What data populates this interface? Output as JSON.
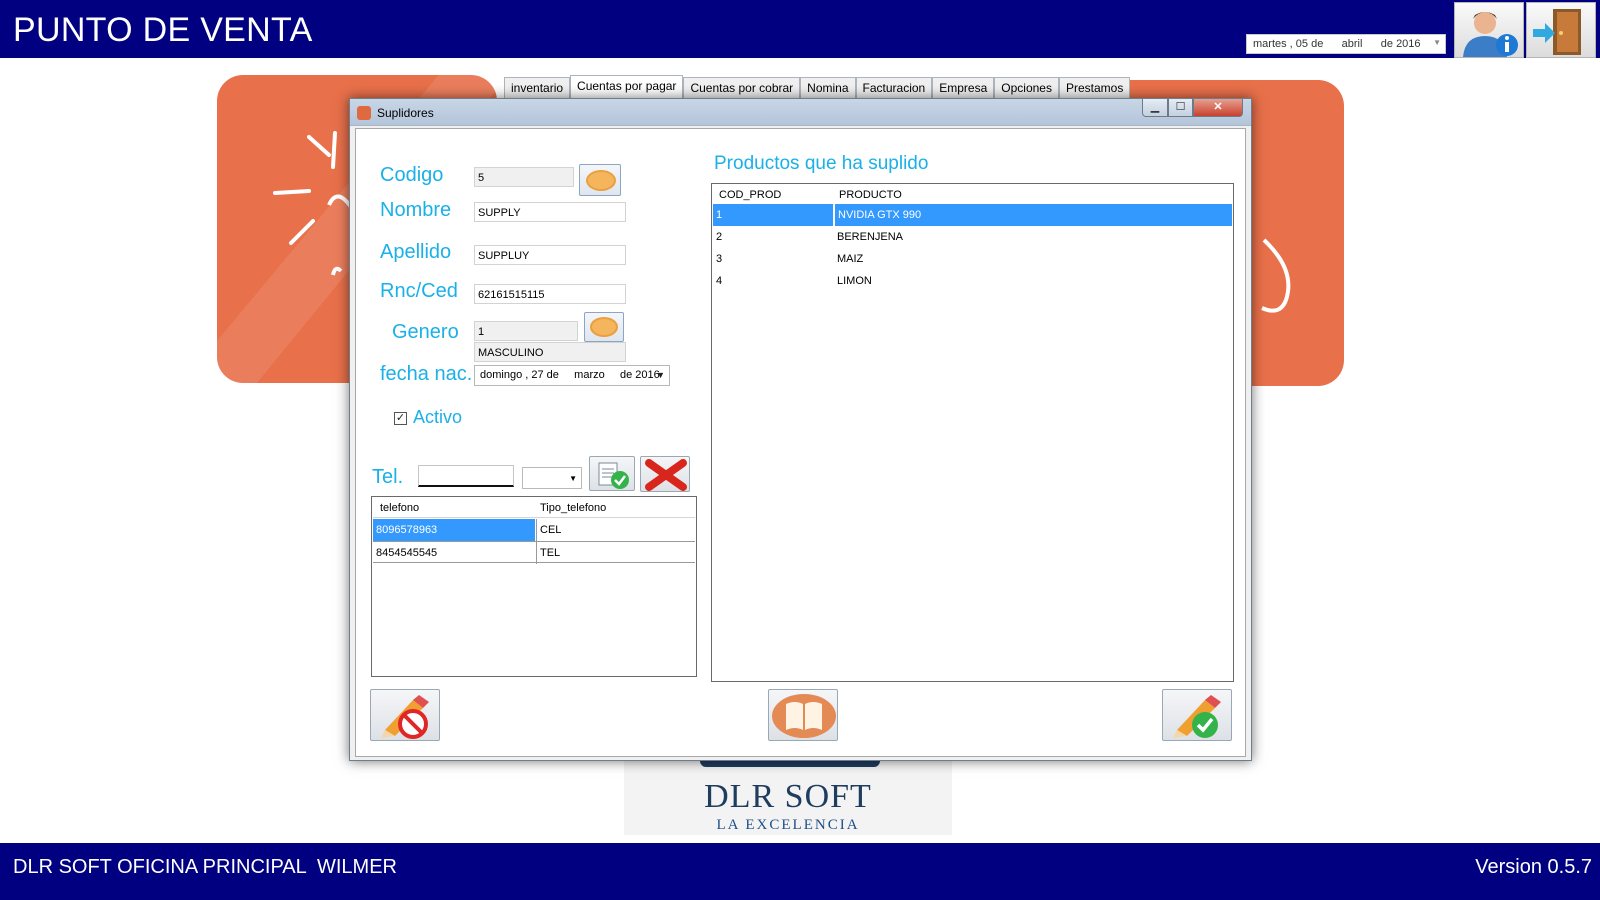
{
  "app": {
    "title": "PUNTO DE VENTA",
    "date": "martes , 05 de      abril      de 2016"
  },
  "tabs": [
    {
      "label": "inventario"
    },
    {
      "label": "Cuentas por pagar"
    },
    {
      "label": "Cuentas por cobrar"
    },
    {
      "label": "Nomina"
    },
    {
      "label": "Facturacion"
    },
    {
      "label": "Empresa"
    },
    {
      "label": "Opciones"
    },
    {
      "label": "Prestamos"
    }
  ],
  "dialog": {
    "title": "Suplidores",
    "form": {
      "codigo_label": "Codigo",
      "codigo_value": "5",
      "nombre_label": "Nombre",
      "nombre_value": "SUPPLY",
      "apellido_label": "Apellido",
      "apellido_value": "SUPPLUY",
      "rnc_label": "Rnc/Ced",
      "rnc_value": "62161515115",
      "genero_label": "Genero",
      "genero_code": "1",
      "genero_name": "MASCULINO",
      "fecha_label": "fecha nac.",
      "fecha_value": "domingo , 27 de     marzo     de 2016",
      "activo_label": "Activo",
      "activo_checked": true,
      "tel_label": "Tel."
    },
    "phones": {
      "headers": [
        "telefono",
        "Tipo_telefono"
      ],
      "rows": [
        {
          "telefono": "8096578963",
          "tipo": "CEL"
        },
        {
          "telefono": "8454545545",
          "tipo": "TEL"
        }
      ]
    },
    "products": {
      "title": "Productos que ha suplido",
      "headers": [
        "COD_PROD",
        "PRODUCTO"
      ],
      "rows": [
        {
          "cod": "1",
          "producto": "NVIDIA GTX 990"
        },
        {
          "cod": "2",
          "producto": "BERENJENA"
        },
        {
          "cod": "3",
          "producto": "MAIZ"
        },
        {
          "cod": "4",
          "producto": "LIMON"
        }
      ]
    }
  },
  "logo": {
    "main": "DLR SOFT",
    "sub": "LA EXCELENCIA"
  },
  "footer": {
    "office": "DLR SOFT OFICINA PRINCIPAL",
    "user": "WILMER",
    "version": "Version 0.5.7"
  },
  "colors": {
    "bar": "#000080",
    "label": "#1ab0e8",
    "card": "#e8704a",
    "selection": "#3399ff"
  },
  "icons": [
    "user-info-icon",
    "exit-door-icon",
    "search-icon",
    "add-phone-icon",
    "delete-x-icon",
    "cancel-edit-icon",
    "book-icon",
    "save-edit-icon"
  ]
}
